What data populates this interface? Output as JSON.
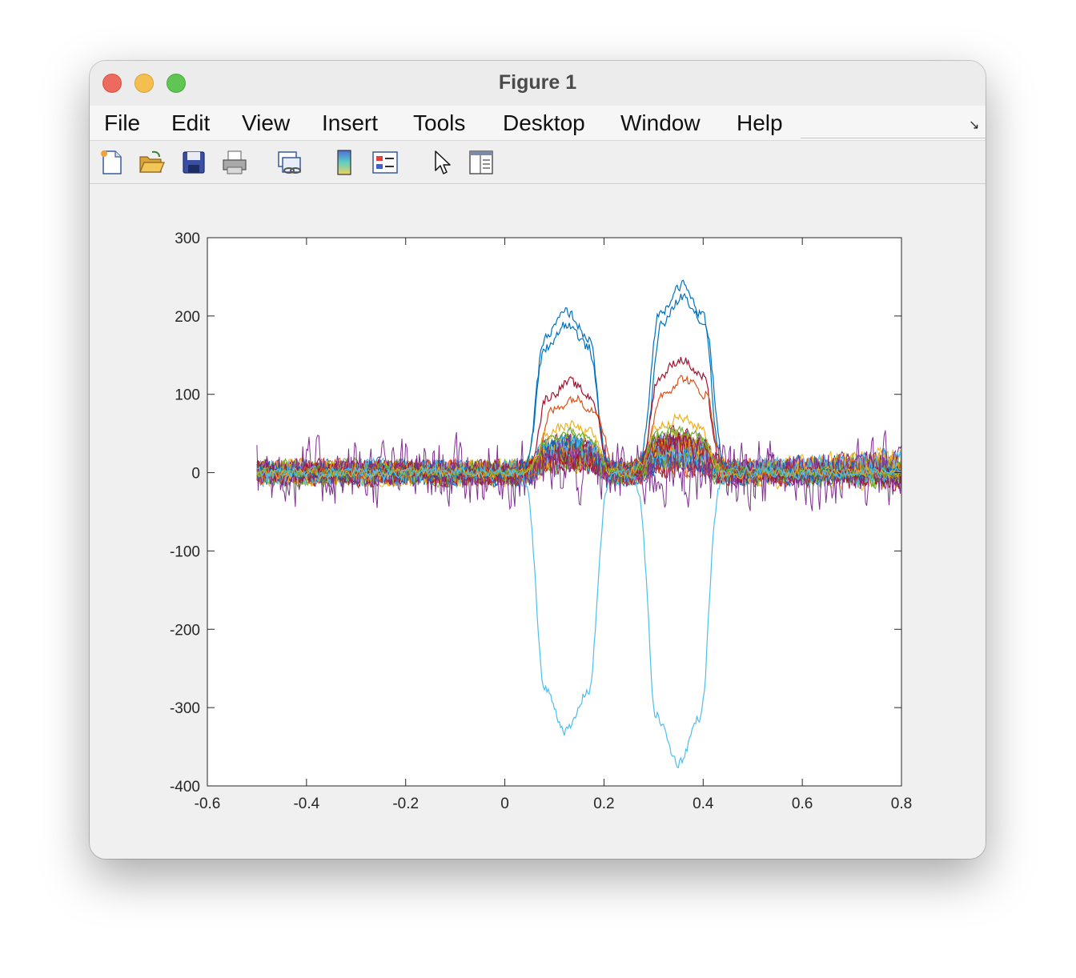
{
  "window": {
    "title": "Figure 1"
  },
  "menu": {
    "items": [
      "File",
      "Edit",
      "View",
      "Insert",
      "Tools",
      "Desktop",
      "Window",
      "Help"
    ]
  },
  "toolbar": {
    "buttons": [
      "new-figure-icon",
      "open-file-icon",
      "save-icon",
      "print-icon",
      "link-plot-icon",
      "colorbar-icon",
      "legend-icon",
      "pointer-icon",
      "property-inspector-icon"
    ]
  },
  "chart_data": {
    "type": "line",
    "title": "",
    "xlabel": "",
    "ylabel": "",
    "xlim": [
      -0.6,
      0.8
    ],
    "ylim": [
      -400,
      300
    ],
    "x_ticks": [
      "-0.6",
      "-0.4",
      "-0.2",
      "0",
      "0.2",
      "0.4",
      "0.6",
      "0.8"
    ],
    "y_ticks": [
      "300",
      "200",
      "100",
      "0",
      "-100",
      "-200",
      "-300",
      "-400"
    ],
    "grid": false,
    "x_range_of_data": [
      -0.5,
      0.8
    ],
    "series": [
      {
        "color": "#0072BD",
        "peaks": [
          {
            "x": 0.125,
            "y": 205
          },
          {
            "x": 0.355,
            "y": 240
          }
        ]
      },
      {
        "color": "#0072BD",
        "peaks": [
          {
            "x": 0.125,
            "y": 190
          },
          {
            "x": 0.36,
            "y": 225
          }
        ]
      },
      {
        "color": "#A2142F",
        "peaks": [
          {
            "x": 0.13,
            "y": 115
          },
          {
            "x": 0.355,
            "y": 145
          }
        ]
      },
      {
        "color": "#D95319",
        "peaks": [
          {
            "x": 0.14,
            "y": 95
          },
          {
            "x": 0.36,
            "y": 120
          }
        ]
      },
      {
        "color": "#EDB120",
        "peaks": [
          {
            "x": 0.13,
            "y": 60
          },
          {
            "x": 0.35,
            "y": 70
          }
        ]
      },
      {
        "color": "#77AC30",
        "peaks": [
          {
            "x": 0.13,
            "y": 50
          },
          {
            "x": 0.35,
            "y": 55
          }
        ]
      },
      {
        "color": "#4DBEEE",
        "peaks": [
          {
            "x": 0.125,
            "y": -330
          },
          {
            "x": 0.35,
            "y": -370
          }
        ]
      },
      {
        "color": "#7E2F8E",
        "peaks": []
      }
    ]
  }
}
